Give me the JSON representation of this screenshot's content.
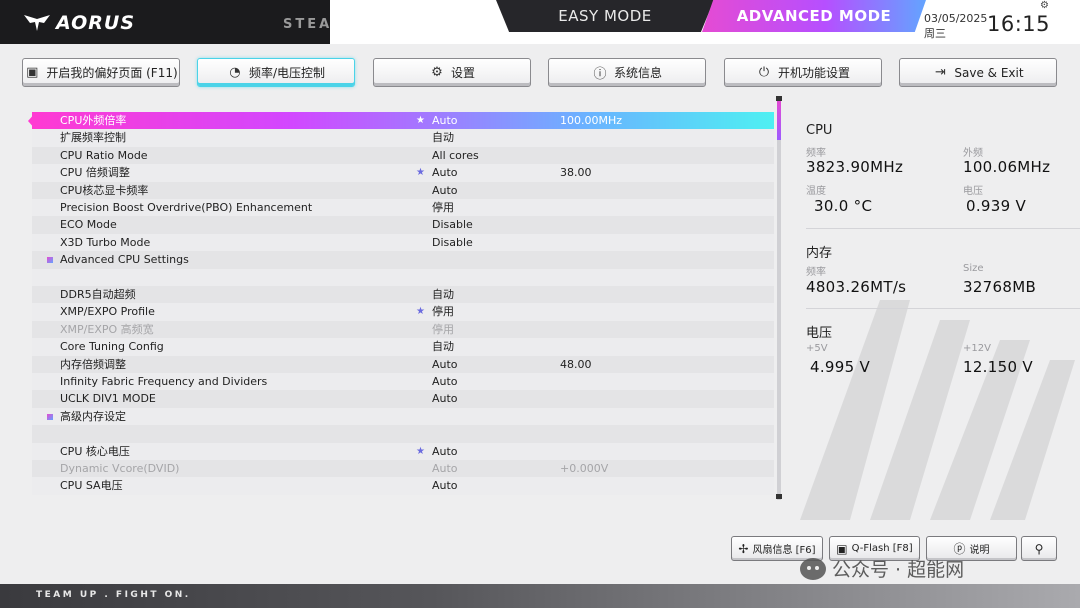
{
  "header": {
    "brand": "AORUS",
    "steam_partial": "STEA",
    "easy_mode": "EASY MODE",
    "advanced_mode": "ADVANCED MODE",
    "date": "03/05/2025",
    "weekday": "周三",
    "time": "16:15"
  },
  "tabs": [
    {
      "label": "开启我的偏好页面 (F11)",
      "icon": "favorites-icon"
    },
    {
      "label": "频率/电压控制",
      "icon": "gauge-icon",
      "active": true
    },
    {
      "label": "设置",
      "icon": "gear-icon"
    },
    {
      "label": "系统信息",
      "icon": "info-icon"
    },
    {
      "label": "开机功能设置",
      "icon": "power-icon"
    },
    {
      "label": "Save & Exit",
      "icon": "exit-icon"
    }
  ],
  "settings": [
    {
      "label": "CPU外频倍率",
      "star": true,
      "value": "Auto",
      "value2": "100.00MHz",
      "selected": true
    },
    {
      "label": "扩展频率控制",
      "value": "自动"
    },
    {
      "label": "CPU Ratio Mode",
      "value": "All cores"
    },
    {
      "label": "CPU 倍频调整",
      "star": true,
      "value": "Auto",
      "value2": "38.00"
    },
    {
      "label": "CPU核芯显卡频率",
      "value": "Auto"
    },
    {
      "label": "Precision Boost Overdrive(PBO) Enhancement",
      "value": "停用"
    },
    {
      "label": "ECO Mode",
      "value": "Disable"
    },
    {
      "label": "X3D Turbo Mode",
      "value": "Disable"
    },
    {
      "label": "Advanced CPU Settings",
      "bullet": true
    },
    {
      "label": ""
    },
    {
      "label": "DDR5自动超频",
      "value": "自动"
    },
    {
      "label": "XMP/EXPO Profile",
      "star": true,
      "value": "停用"
    },
    {
      "label": "XMP/EXPO 高频宽",
      "value": "停用",
      "disabled": true
    },
    {
      "label": "Core Tuning Config",
      "value": "自动"
    },
    {
      "label": "内存倍频调整",
      "value": "Auto",
      "value2": "48.00"
    },
    {
      "label": "Infinity Fabric Frequency and Dividers",
      "value": "Auto"
    },
    {
      "label": "UCLK DIV1 MODE",
      "value": "Auto"
    },
    {
      "label": "高级内存设定",
      "bullet": true
    },
    {
      "label": ""
    },
    {
      "label": "CPU 核心电压",
      "star": true,
      "value": "Auto"
    },
    {
      "label": "Dynamic Vcore(DVID)",
      "value": "Auto",
      "value2": "+0.000V",
      "disabled": true
    },
    {
      "label": "CPU SA电压",
      "value": "Auto"
    }
  ],
  "info": {
    "cpu": {
      "title": "CPU",
      "freq_label": "频率",
      "freq": "3823.90MHz",
      "bclk_label": "外频",
      "bclk": "100.06MHz",
      "temp_label": "温度",
      "temp": "30.0 °C",
      "volt_label": "电压",
      "volt": "0.939 V"
    },
    "mem": {
      "title": "内存",
      "freq_label": "频率",
      "freq": "4803.26MT/s",
      "size_label": "Size",
      "size": "32768MB"
    },
    "volt": {
      "title": "电压",
      "v5_label": "+5V",
      "v5": "4.995 V",
      "v12_label": "+12V",
      "v12": "12.150 V"
    }
  },
  "bottom": {
    "fan": "风扇信息 [F6]",
    "qflash": "Q-Flash [F8]",
    "help": "说明",
    "watermark": "公众号 · 超能网"
  },
  "footer": "TEAM UP . FIGHT ON."
}
